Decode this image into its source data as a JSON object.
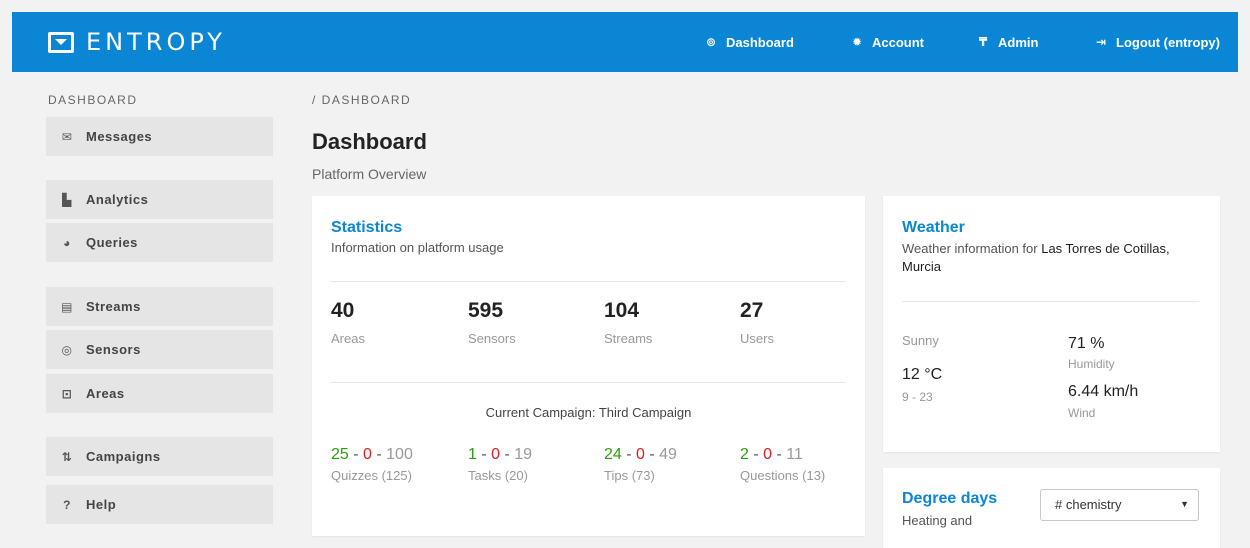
{
  "brand": {
    "name": "ENTROPY"
  },
  "nav": {
    "dashboard": "Dashboard",
    "account": "Account",
    "admin": "Admin",
    "logout": "Logout (entropy)"
  },
  "sidebar": {
    "title": "DASHBOARD",
    "items": [
      {
        "label": "Messages",
        "icon": "messages-icon"
      },
      {
        "label": "Analytics",
        "icon": "bar-chart-icon"
      },
      {
        "label": "Queries",
        "icon": "pie-chart-icon"
      },
      {
        "label": "Streams",
        "icon": "table-icon"
      },
      {
        "label": "Sensors",
        "icon": "target-icon"
      },
      {
        "label": "Areas",
        "icon": "map-icon"
      },
      {
        "label": "Campaigns",
        "icon": "campaign-icon"
      },
      {
        "label": "Help",
        "icon": "question-icon"
      }
    ]
  },
  "breadcrumb": "/ DASHBOARD",
  "page": {
    "title": "Dashboard",
    "subtitle": "Platform Overview"
  },
  "statistics": {
    "title": "Statistics",
    "description": "Information on platform usage",
    "counts": [
      {
        "value": "40",
        "label": "Areas"
      },
      {
        "value": "595",
        "label": "Sensors"
      },
      {
        "value": "104",
        "label": "Streams"
      },
      {
        "value": "27",
        "label": "Users"
      }
    ],
    "campaign": "Current Campaign: Third Campaign",
    "campaign_stats": [
      {
        "green": "25",
        "red": "0",
        "total": "100",
        "label": "Quizzes (125)"
      },
      {
        "green": "1",
        "red": "0",
        "total": "19",
        "label": "Tasks (20)"
      },
      {
        "green": "24",
        "red": "0",
        "total": "49",
        "label": "Tips (73)"
      },
      {
        "green": "2",
        "red": "0",
        "total": "11",
        "label": "Questions (13)"
      }
    ]
  },
  "weather": {
    "title": "Weather",
    "prefix": "Weather information for ",
    "location": "Las Torres de Cotillas, Murcia",
    "condition": "Sunny",
    "temperature": "12 °C",
    "range": "9 - 23",
    "humidity_value": "71 %",
    "humidity_label": "Humidity",
    "wind_value": "6.44 km/h",
    "wind_label": "Wind"
  },
  "degree_days": {
    "title": "Degree days",
    "subtitle": "Heating and",
    "select_value": "# chemistry"
  },
  "colors": {
    "primary": "#0b86d4",
    "positive": "#2a9d0c",
    "negative": "#e01b1b"
  }
}
